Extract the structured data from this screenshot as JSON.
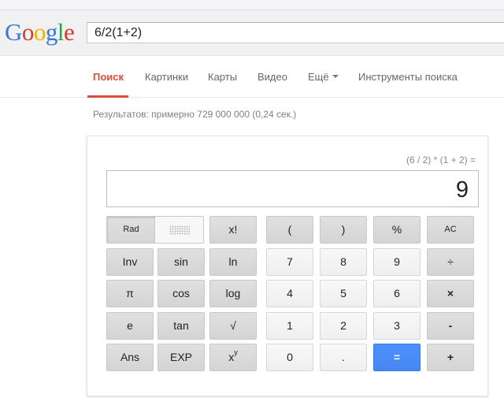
{
  "logo": {
    "letters": [
      "G",
      "o",
      "o",
      "g",
      "l",
      "e"
    ]
  },
  "search": {
    "query": "6/2(1+2)"
  },
  "tabs": [
    {
      "label": "Поиск",
      "active": true
    },
    {
      "label": "Картинки"
    },
    {
      "label": "Карты"
    },
    {
      "label": "Видео"
    },
    {
      "label": "Ещё",
      "icon": "caret-down-icon"
    },
    {
      "label": "Инструменты поиска"
    }
  ],
  "stats": "Результатов: примерно 729 000 000 (0,24 сек.)",
  "calculator": {
    "expression": "(6 / 2) * (1 + 2) =",
    "result": "9",
    "keys": {
      "rad": "Rad",
      "factorial": "x!",
      "lparen": "(",
      "rparen": ")",
      "percent": "%",
      "clear": "AC",
      "inv": "Inv",
      "sin": "sin",
      "ln": "ln",
      "n7": "7",
      "n8": "8",
      "n9": "9",
      "divide": "÷",
      "pi": "π",
      "cos": "cos",
      "log": "log",
      "n4": "4",
      "n5": "5",
      "n6": "6",
      "multiply": "×",
      "e": "e",
      "tan": "tan",
      "sqrt": "√",
      "n1": "1",
      "n2": "2",
      "n3": "3",
      "minus": "-",
      "ans": "Ans",
      "exp": "EXP",
      "power_base": "x",
      "power_exp": "y",
      "n0": "0",
      "dot": ".",
      "equals": "=",
      "plus": "+"
    }
  },
  "colors": {
    "accent": "#dd4b39",
    "equals_button": "#4d90fe"
  }
}
